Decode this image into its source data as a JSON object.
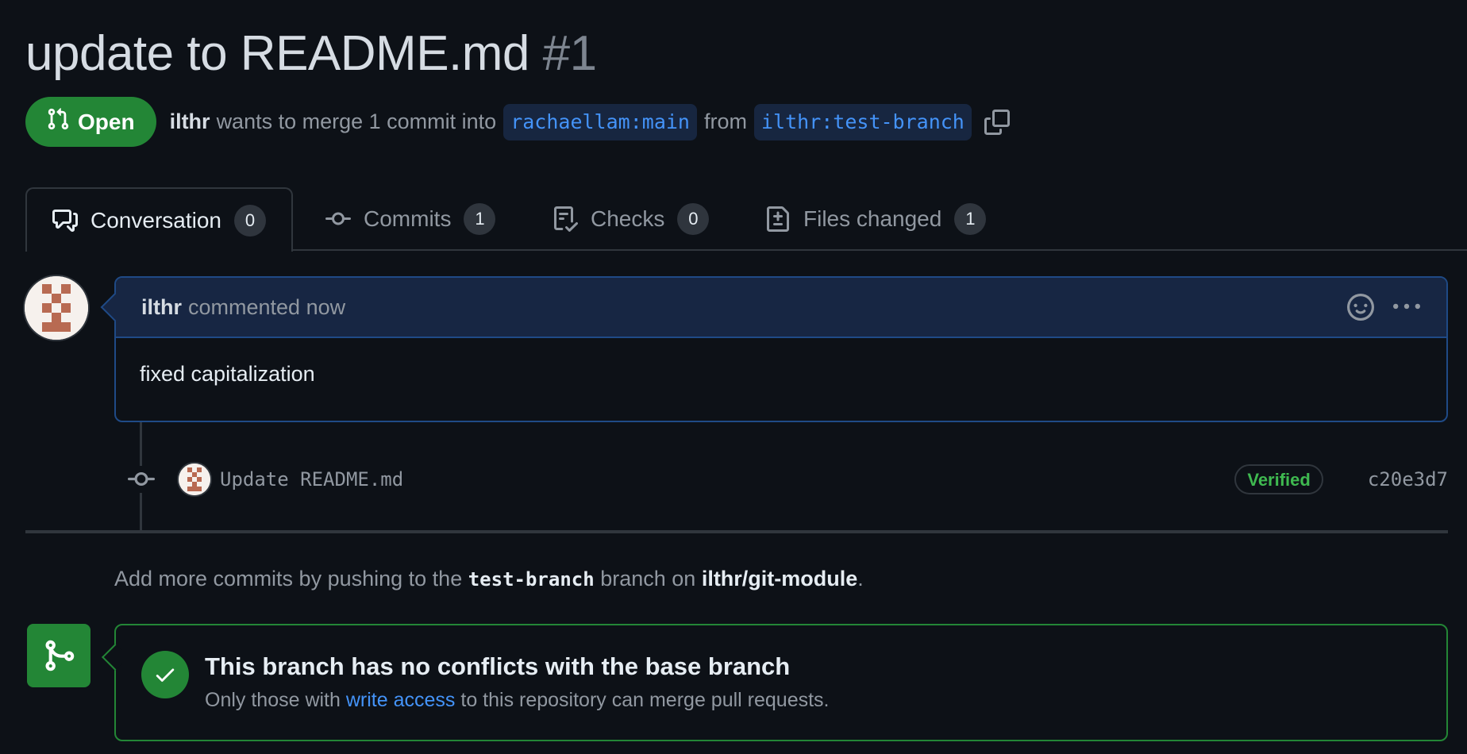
{
  "pr": {
    "title": "update to README.md",
    "number": "#1",
    "state_label": "Open",
    "author": "ilthr",
    "merge_text": "wants to merge 1 commit into",
    "base_branch": "rachaellam:main",
    "from_text": "from",
    "head_branch": "ilthr:test-branch"
  },
  "tabs": [
    {
      "label": "Conversation",
      "count": "0",
      "icon": "comment-discussion-icon"
    },
    {
      "label": "Commits",
      "count": "1",
      "icon": "git-commit-icon"
    },
    {
      "label": "Checks",
      "count": "0",
      "icon": "checklist-icon"
    },
    {
      "label": "Files changed",
      "count": "1",
      "icon": "file-diff-icon"
    }
  ],
  "comment": {
    "author": "ilthr",
    "action": "commented now",
    "body": "fixed capitalization"
  },
  "commit": {
    "message": "Update README.md",
    "verified_label": "Verified",
    "sha": "c20e3d7"
  },
  "hint": {
    "prefix": "Add more commits by pushing to the",
    "branch": "test-branch",
    "middle": "branch on",
    "repo": "ilthr/git-module",
    "suffix": "."
  },
  "merge": {
    "title": "This branch has no conflicts with the base branch",
    "sub_prefix": "Only those with",
    "sub_link": "write access",
    "sub_suffix": "to this repository can merge pull requests."
  },
  "colors": {
    "background": "#0d1117",
    "open_green": "#238636",
    "link_blue": "#4493f8",
    "comment_border": "#1f4a86",
    "verified_green": "#3fb950"
  }
}
